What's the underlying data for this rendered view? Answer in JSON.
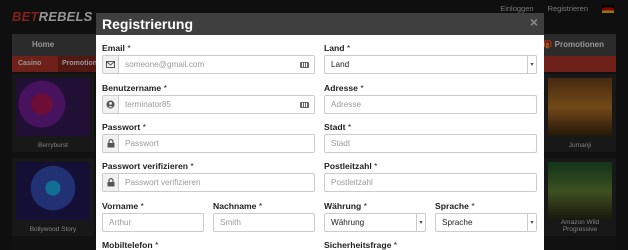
{
  "site": {
    "logo_prefix": "BET",
    "logo_suffix": "REBELS",
    "login_link": "Einloggen",
    "register_link": "Registrieren",
    "nav_home": "Home",
    "nav_promotions": "Promotionen",
    "tab_casino": "Casino",
    "tab_promos": "Promotionen",
    "games": [
      {
        "name": "Berryburst"
      },
      {
        "name": "Bollywood Story"
      },
      {
        "name": "Jumanji"
      },
      {
        "name": "Amazon Wild Progressive"
      }
    ]
  },
  "modal": {
    "title": "Registrierung",
    "close": "×",
    "fields": {
      "email": {
        "label": "Email",
        "placeholder": "someone@gmail.com"
      },
      "land": {
        "label": "Land",
        "value": "Land"
      },
      "benutzername": {
        "label": "Benutzername",
        "placeholder": "terminator85"
      },
      "adresse": {
        "label": "Adresse",
        "placeholder": "Adresse"
      },
      "passwort": {
        "label": "Passwort",
        "placeholder": "Passwort"
      },
      "stadt": {
        "label": "Stadt",
        "placeholder": "Stadt"
      },
      "passwort_verifizieren": {
        "label": "Passwort verifizieren",
        "placeholder": "Passwort verifizieren"
      },
      "postleitzahl": {
        "label": "Postleitzahl",
        "placeholder": "Postleitzahl"
      },
      "vorname": {
        "label": "Vorname",
        "placeholder": "Arthur"
      },
      "nachname": {
        "label": "Nachname",
        "placeholder": "Smith"
      },
      "waehrung": {
        "label": "Währung",
        "value": "Währung"
      },
      "sprache": {
        "label": "Sprache",
        "value": "Sprache"
      },
      "mobiltelefon": {
        "label": "Mobiltelefon"
      },
      "sicherheitsfrage": {
        "label": "Sicherheitsfrage"
      }
    },
    "required_mark": "*"
  }
}
